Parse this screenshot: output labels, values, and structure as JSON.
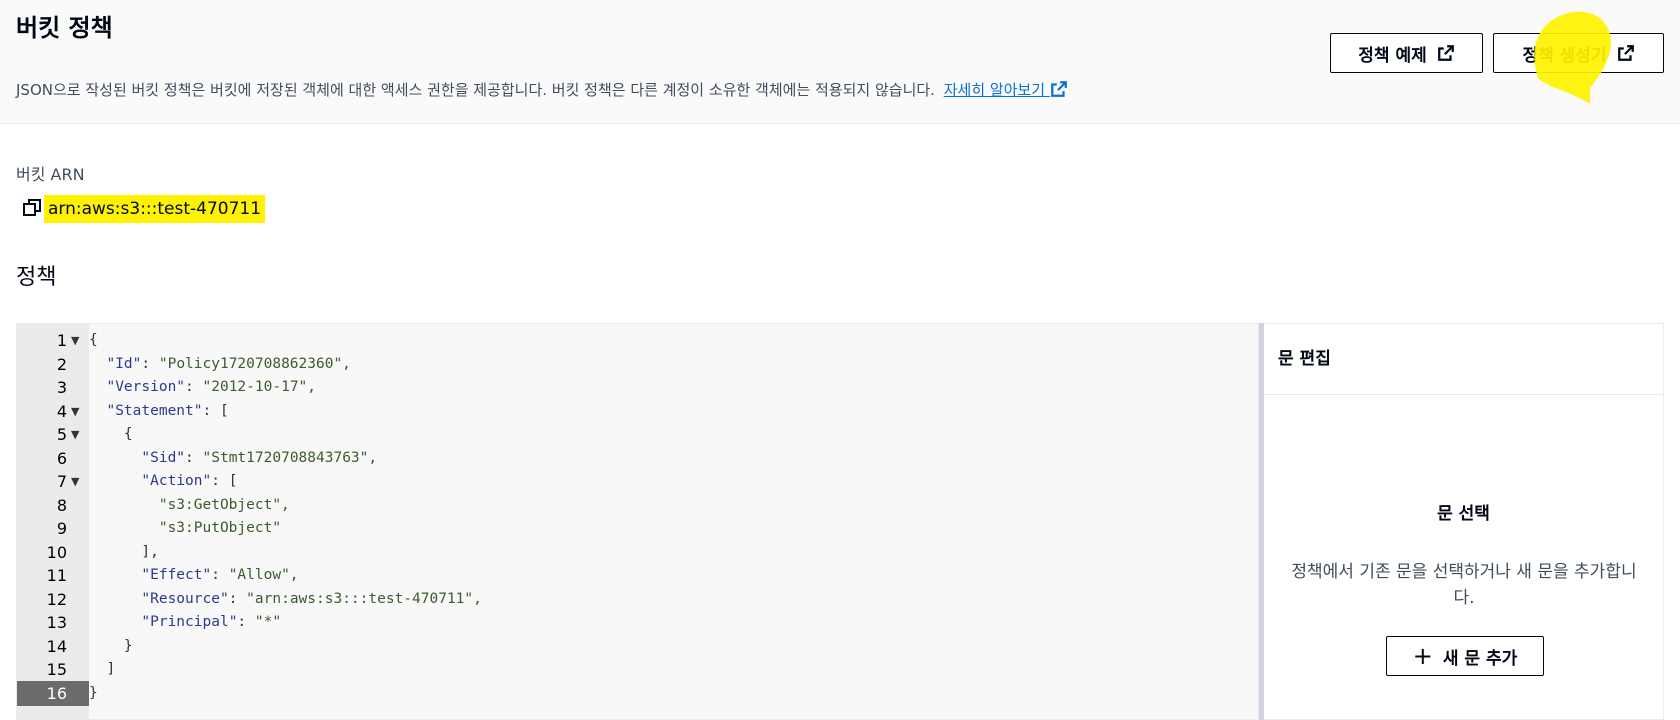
{
  "header": {
    "title": "버킷 정책",
    "description": "JSON으로 작성된 버킷 정책은 버킷에 저장된 객체에 대한 액세스 권한을 제공합니다. 버킷 정책은 다른 계정이 소유한 객체에는 적용되지 않습니다.",
    "learn_more": "자세히 알아보기",
    "btn_example": "정책 예제",
    "btn_generator": "정책 생성기"
  },
  "arn": {
    "label": "버킷 ARN",
    "value": "arn:aws:s3:::test-470711"
  },
  "policy": {
    "title": "정책"
  },
  "editor": {
    "lines": [
      {
        "n": "1",
        "fold": true,
        "text": "{"
      },
      {
        "n": "2",
        "fold": false,
        "key": "\"Id\"",
        "rest": "\"Policy1720708862360\",",
        "indent": "  "
      },
      {
        "n": "3",
        "fold": false,
        "key": "\"Version\"",
        "rest": "\"2012-10-17\",",
        "indent": "  "
      },
      {
        "n": "4",
        "fold": true,
        "key": "\"Statement\"",
        "rest": "[",
        "indent": "  ",
        "restPunct": true
      },
      {
        "n": "5",
        "fold": true,
        "text": "    {"
      },
      {
        "n": "6",
        "fold": false,
        "key": "\"Sid\"",
        "rest": "\"Stmt1720708843763\",",
        "indent": "      "
      },
      {
        "n": "7",
        "fold": true,
        "key": "\"Action\"",
        "rest": "[",
        "indent": "      ",
        "restPunct": true
      },
      {
        "n": "8",
        "fold": false,
        "str": "\"s3:GetObject\",",
        "indent": "        "
      },
      {
        "n": "9",
        "fold": false,
        "str": "\"s3:PutObject\"",
        "indent": "        "
      },
      {
        "n": "10",
        "fold": false,
        "text": "      ],"
      },
      {
        "n": "11",
        "fold": false,
        "key": "\"Effect\"",
        "rest": "\"Allow\",",
        "indent": "      "
      },
      {
        "n": "12",
        "fold": false,
        "key": "\"Resource\"",
        "rest": "\"arn:aws:s3:::test-470711\",",
        "indent": "      "
      },
      {
        "n": "13",
        "fold": false,
        "key": "\"Principal\"",
        "rest": "\"*\"",
        "indent": "      "
      },
      {
        "n": "14",
        "fold": false,
        "text": "    }"
      },
      {
        "n": "15",
        "fold": false,
        "text": "  ]"
      },
      {
        "n": "16",
        "fold": false,
        "text": "}",
        "active": true
      }
    ]
  },
  "side_panel": {
    "title": "문 편집",
    "subtitle": "문 선택",
    "description": "정책에서 기존 문을 선택하거나 새 문을 추가합니다.",
    "add_button": "새 문 추가"
  },
  "colors": {
    "highlight": "#fff200",
    "link": "#0972d3"
  }
}
